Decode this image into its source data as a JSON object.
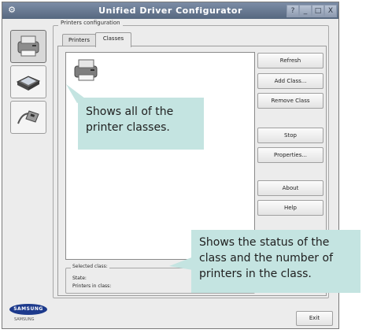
{
  "window": {
    "title": "Unified Driver Configurator",
    "controls": [
      "?",
      "_",
      "□",
      "X"
    ]
  },
  "sidebar": {
    "items": [
      {
        "name": "printers-config",
        "icon": "printer-icon",
        "active": true
      },
      {
        "name": "scanners-config",
        "icon": "scanner-icon",
        "active": false
      },
      {
        "name": "ports-config",
        "icon": "port-icon",
        "active": false
      }
    ]
  },
  "group": {
    "label": "Printers configuration"
  },
  "tabs": [
    {
      "label": "Printers",
      "active": false
    },
    {
      "label": "Classes",
      "active": true
    }
  ],
  "buttons": {
    "refresh": "Refresh",
    "add_class": "Add Class...",
    "remove_class": "Remove Class",
    "stop": "Stop",
    "properties": "Properties...",
    "about": "About",
    "help": "Help",
    "exit": "Exit"
  },
  "selected": {
    "label": "Selected class:",
    "state_label": "State:",
    "printers_label": "Printers in class:"
  },
  "callouts": {
    "classes": "Shows all of the printer classes.",
    "status": "Shows the status of the class and the number of printers in the class."
  },
  "brand": {
    "logo": "SAMSUNG",
    "sub": "SAMSUNG"
  },
  "colors": {
    "titlebar": "#56677f",
    "callout": "#c4e4e1",
    "logo": "#1d3a8c"
  }
}
